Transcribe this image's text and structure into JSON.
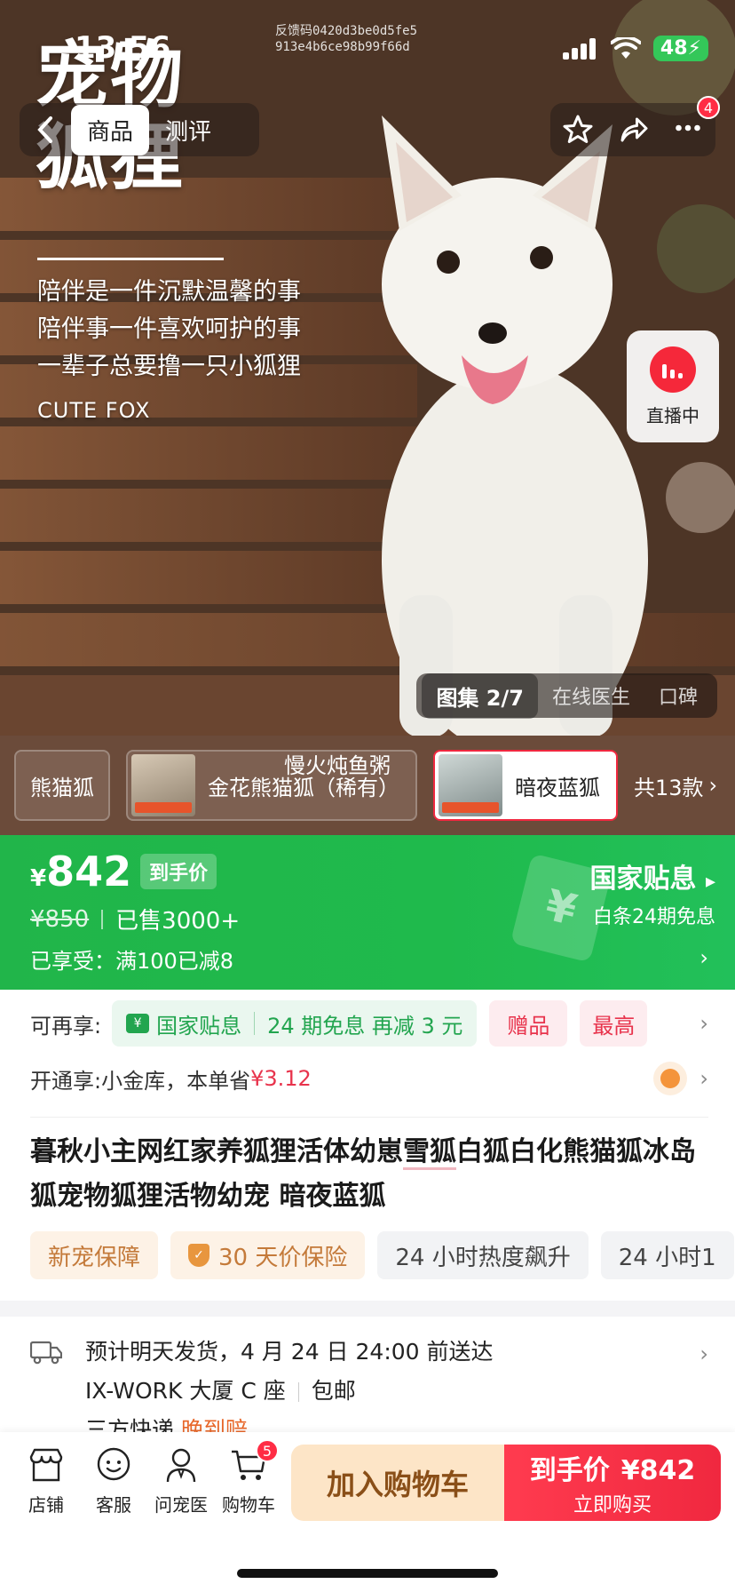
{
  "status": {
    "time": "13:56",
    "battery": "48"
  },
  "feedback_code": {
    "line1": "反馈码0420d3be0d5fe5",
    "line2": "913e4b6ce98b99f66d"
  },
  "hero": {
    "title_line1": "宠物",
    "title_line2": "狐狸",
    "poem": [
      "陪伴是一件沉默温馨的事",
      "陪伴事一件喜欢呵护的事",
      "一辈子总要撸一只小狐狸"
    ],
    "subtitle": "CUTE FOX"
  },
  "nav": {
    "tabs": [
      "商品",
      "测评"
    ],
    "badge_count": "4"
  },
  "live": {
    "label": "直播中"
  },
  "gallery": {
    "active": "图集 2/7",
    "tabs": [
      "在线医生",
      "口碑"
    ]
  },
  "variants": {
    "items": [
      "熊猫狐",
      "金花熊猫狐（稀有）",
      "暗夜蓝狐"
    ],
    "overlay_text": "慢火炖鱼粥",
    "more": "共13款"
  },
  "price": {
    "currency": "¥",
    "amount": "842",
    "tag": "到手价",
    "original": "¥850",
    "sold": "已售3000+",
    "discount": "已享受：满100已减8",
    "gov_title": "国家贴息",
    "gov_sub": "白条24期免息"
  },
  "promo": {
    "label": "可再享:",
    "gov": "国家贴息",
    "interest": "24 期免息 再减 3 元",
    "gift": "赠品",
    "max": "最高"
  },
  "jinku": {
    "label": "开通享:",
    "text": "小金库，本单省",
    "amount": "¥3.12"
  },
  "title": {
    "part1": "暮秋小主网红家养狐狸活体幼崽",
    "highlight": "雪狐",
    "part2": "白狐白化熊猫狐冰岛狐宠物狐狸活物幼宠 暗夜蓝狐"
  },
  "tags": [
    "新宠保障",
    "30 天价保险",
    "24 小时热度飙升",
    "24 小时1"
  ],
  "shipping": {
    "line1": "预计明天发货，4 月 24 日 24:00 前送达",
    "address": "IX-WORK 大厦 C 座",
    "postage": "包邮",
    "courier": "三方快递",
    "late_comp": "晚到赔"
  },
  "bottom": {
    "icons": [
      "店铺",
      "客服",
      "问宠医",
      "购物车"
    ],
    "cart_count": "5",
    "add_cart": "加入购物车",
    "buy_price_label": "到手价",
    "buy_price": "¥842",
    "buy_now": "立即购买"
  },
  "colors": {
    "green": "#21b54a",
    "red": "#f0283f",
    "cart_bg": "#fde5c7"
  }
}
